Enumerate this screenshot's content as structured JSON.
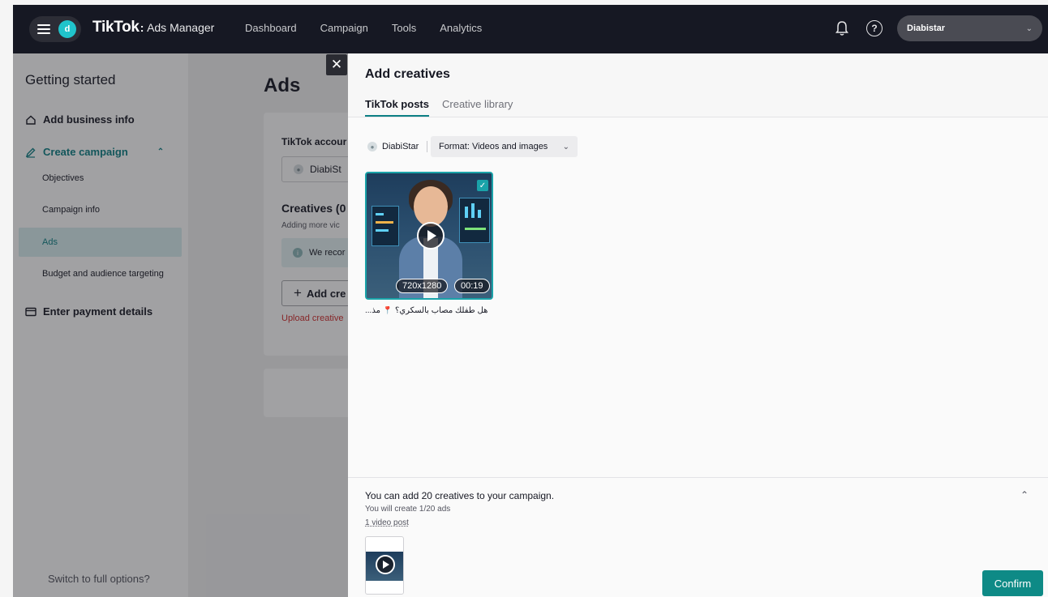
{
  "header": {
    "avatar_letter": "d",
    "logo_brand": "TikTok",
    "logo_separator": ":",
    "logo_product": "Ads Manager",
    "nav": [
      "Dashboard",
      "Campaign",
      "Tools",
      "Analytics"
    ],
    "account_name": "Diabistar",
    "help_glyph": "?"
  },
  "sidebar": {
    "title": "Getting started",
    "add_business": "Add business info",
    "create_campaign": "Create campaign",
    "steps": [
      "Objectives",
      "Campaign info",
      "Ads",
      "Budget and audience targeting"
    ],
    "active_step": "Ads",
    "payment": "Enter payment details",
    "switch": "Switch to full options?"
  },
  "main": {
    "title": "Ads",
    "account_label": "TikTok accour",
    "account_value": "DiabiSt",
    "creatives_title": "Creatives (0",
    "creatives_hint": "Adding more vic",
    "info_text": "We recor",
    "info_glyph": "i",
    "add_button": "Add cre",
    "error_text": "Upload creative"
  },
  "drawer": {
    "title": "Add creatives",
    "tabs": [
      "TikTok posts",
      "Creative library"
    ],
    "active_tab": "TikTok posts",
    "filter_account": "DiabiStar",
    "format_select": "Format: Videos and images",
    "post": {
      "resolution": "720x1280",
      "duration": "00:19",
      "caption": "هل طفلك مصاب بالسكري؟ 📍 مذ...",
      "selected": true
    },
    "footer": {
      "line1": "You can add 20 creatives to your campaign.",
      "line2": "You will create 1/20 ads",
      "line3": "1 video post",
      "confirm": "Confirm"
    }
  },
  "colors": {
    "accent": "#0c7f84",
    "confirm_bg": "#0e8a86",
    "topbar_bg": "#161823",
    "error": "#d12c2c"
  },
  "icons": {
    "menu": "hamburger-icon",
    "home": "home-icon",
    "edit": "pencil-icon",
    "payment": "card-icon",
    "bell": "bell-icon",
    "help": "help-icon",
    "close": "close-icon",
    "play": "play-icon",
    "check": "check-icon",
    "chevron": "chevron-down-icon"
  }
}
